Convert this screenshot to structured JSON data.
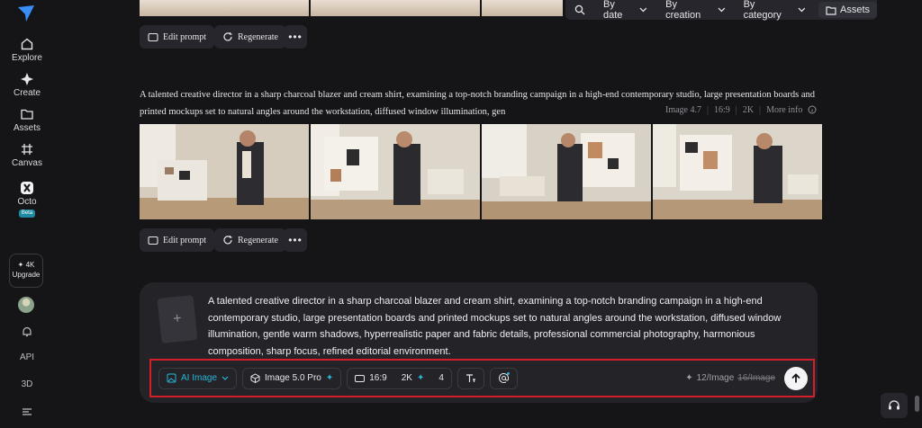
{
  "sidebar": {
    "items": [
      {
        "label": "Explore",
        "icon": "home-icon"
      },
      {
        "label": "Create",
        "icon": "sparkle-icon"
      },
      {
        "label": "Assets",
        "icon": "folder-icon"
      },
      {
        "label": "Canvas",
        "icon": "canvas-icon"
      },
      {
        "label": "Octo",
        "icon": "octo-icon",
        "badge": "Beta"
      }
    ],
    "upgrade": {
      "title": "✦ 4K",
      "label": "Upgrade"
    },
    "bottom": {
      "api": "API",
      "three_d": "3D"
    }
  },
  "filters": {
    "by_date": "By date",
    "by_creation": "By creation",
    "by_category": "By category",
    "assets": "Assets"
  },
  "actions": {
    "edit_prompt": "Edit prompt",
    "regenerate": "Regenerate"
  },
  "generation": {
    "prompt": "A talented creative director in a sharp charcoal blazer and cream shirt, examining a top-notch branding campaign in a high-end contemporary studio, large presentation boards and printed mockups set to natural angles around the workstation, diffused window illumination, gen",
    "model": "Image 4.7",
    "ratio": "16:9",
    "resolution": "2K",
    "more_info": "More info"
  },
  "composer": {
    "text": "A talented creative director in a sharp charcoal blazer and cream shirt, examining a top-notch branding campaign in a high-end contemporary studio, large presentation boards and printed mockups set to natural angles around the workstation, diffused window illumination, gentle warm shadows, hyperrealistic paper and fabric details, professional commercial photography, harmonious composition, sharp focus, refined editorial environment.",
    "mode": "AI Image",
    "model": "Image 5.0 Pro",
    "ratio": "16:9",
    "resolution": "2K",
    "count": "4",
    "credits": "12/Image",
    "credits_old": "16/Image"
  },
  "colors": {
    "accent": "#29b6d6",
    "highlight_border": "#d2202a",
    "background": "#151518"
  }
}
